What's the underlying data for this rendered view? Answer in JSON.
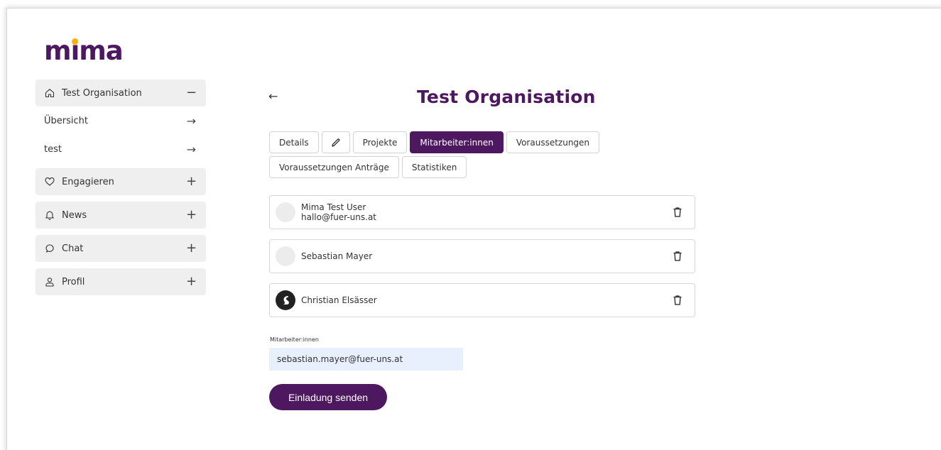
{
  "brand": {
    "logo_text_pre": "m",
    "logo_text_i": "i",
    "logo_text_post": "ma",
    "accent_color": "#4e1860",
    "dot_color": "#ffb000"
  },
  "sidebar": {
    "sections": [
      {
        "label": "Test Organisation",
        "icon": "home-icon",
        "toggle": "−"
      },
      {
        "label": "Engagieren",
        "icon": "heart-icon",
        "toggle": "+"
      },
      {
        "label": "News",
        "icon": "bell-icon",
        "toggle": "+"
      },
      {
        "label": "Chat",
        "icon": "chat-bubble-icon",
        "toggle": "+"
      },
      {
        "label": "Profil",
        "icon": "user-icon",
        "toggle": "+"
      }
    ],
    "sub_items": [
      {
        "label": "Übersicht",
        "arrow": "→"
      },
      {
        "label": "test",
        "arrow": "→"
      }
    ]
  },
  "main": {
    "back_arrow": "←",
    "title": "Test Organisation",
    "tabs": [
      {
        "label": "Details"
      },
      {
        "label": "",
        "icon": "pencil-icon"
      },
      {
        "label": "Projekte"
      },
      {
        "label": "Mitarbeiter:innen",
        "active": true
      },
      {
        "label": "Voraussetzungen"
      },
      {
        "label": "Voraussetzungen Anträge"
      },
      {
        "label": "Statistiken"
      }
    ],
    "members": [
      {
        "name": "Mima Test User",
        "email": "hallo@fuer-uns.at",
        "avatar": "placeholder"
      },
      {
        "name": "Sebastian Mayer",
        "email": "",
        "avatar": "placeholder"
      },
      {
        "name": "Christian Elsässer",
        "email": "",
        "avatar": "squirrel-logo"
      }
    ],
    "invite": {
      "field_label": "Mitarbeiter:innen",
      "field_value": "sebastian.mayer@fuer-uns.at",
      "button_label": "Einladung senden"
    }
  }
}
